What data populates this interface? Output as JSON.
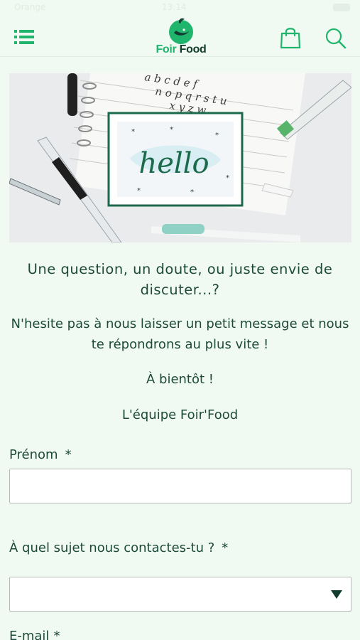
{
  "status_bar": {
    "carrier": "Orange",
    "time": "13:14"
  },
  "header": {
    "logo": {
      "text_part1": "Foir",
      "text_part2": "Food"
    },
    "icons": {
      "menu": "menu-icon",
      "bag": "shopping-bag-icon",
      "search": "search-icon"
    }
  },
  "hero": {
    "image": "photo of a hello lettering card with pens and notebook",
    "card_text": "hello"
  },
  "intro": {
    "title": "Une question, un doute, ou juste envie de discuter...?",
    "body": "N'hesite pas à nous laisser un petit message et nous te répondrons au plus vite !",
    "bye": "À bientôt !",
    "team": "L'équipe Foir'Food"
  },
  "form": {
    "firstname": {
      "label": "Prénom",
      "required": "*",
      "value": ""
    },
    "subject": {
      "label": "À quel sujet nous contactes-tu ?",
      "required": "*",
      "value": ""
    },
    "email": {
      "label": "E-mail",
      "required": "*"
    }
  },
  "colors": {
    "brand_green": "#1fb56d",
    "dark_green": "#123d2e",
    "text": "#1d4a3a",
    "background": "#f1faf2"
  }
}
